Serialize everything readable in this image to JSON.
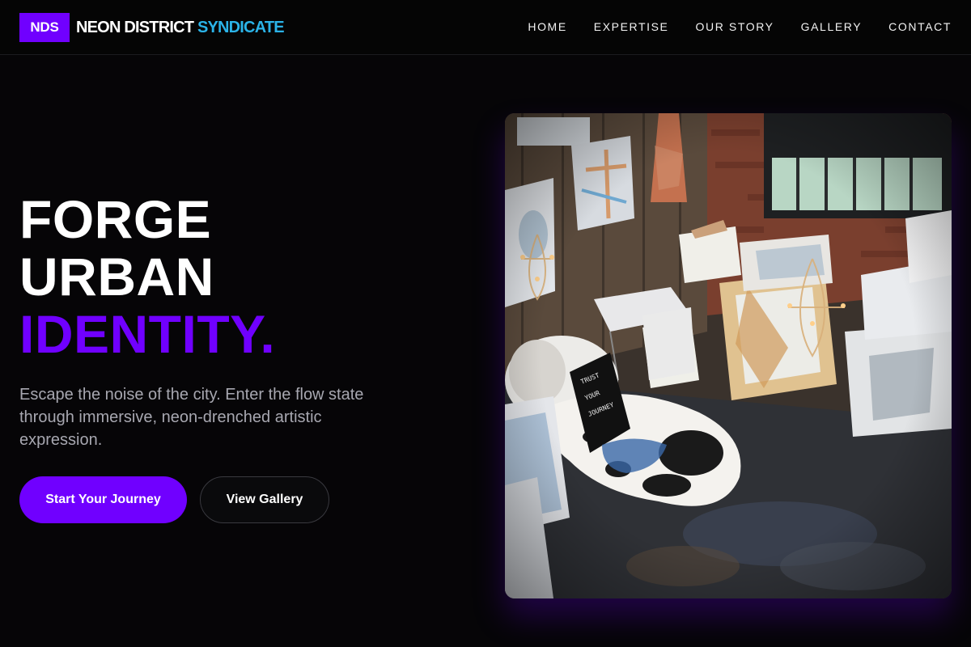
{
  "brand": {
    "badge": "NDS",
    "name_main": "NEON DISTRICT",
    "name_accent": "SYNDICATE"
  },
  "nav": {
    "items": [
      "HOME",
      "EXPERTISE",
      "OUR STORY",
      "GALLERY",
      "CONTACT"
    ]
  },
  "hero": {
    "title_line1": "FORGE",
    "title_line2": "URBAN",
    "title_line3": "IDENTITY.",
    "subtitle": "Escape the noise of the city. Enter the flow state through immersive, neon-drenched artistic expression.",
    "primary_cta": "Start Your Journey",
    "secondary_cta": "View Gallery"
  },
  "image": {
    "alt": "Art studio loft with canvases, chandeliers and a cowhide rug",
    "sign_text": "TRUST YOUR JOURNEY"
  },
  "colors": {
    "accent_purple": "#7000ff",
    "accent_cyan": "#2bb3e8",
    "background": "#060507",
    "muted_text": "#a7a7b0"
  }
}
